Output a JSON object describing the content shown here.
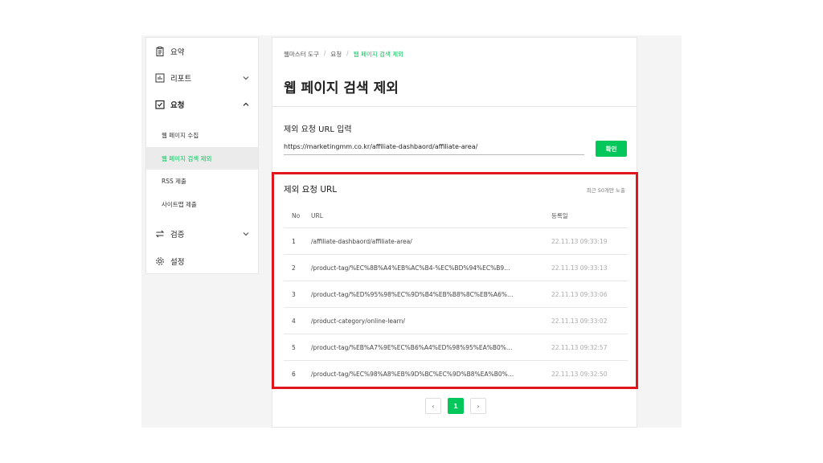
{
  "sidebar": {
    "items": [
      {
        "label": "요약",
        "icon": "clipboard-icon"
      },
      {
        "label": "리포트",
        "icon": "chart-icon"
      },
      {
        "label": "요청",
        "icon": "check-box-icon"
      },
      {
        "label": "검증",
        "icon": "swap-icon"
      },
      {
        "label": "설정",
        "icon": "gear-icon"
      }
    ],
    "sub_items": [
      {
        "label": "웹 페이지 수집"
      },
      {
        "label": "웹 페이지 검색 제외"
      },
      {
        "label": "RSS 제출"
      },
      {
        "label": "사이트맵 제출"
      }
    ]
  },
  "breadcrumb": [
    "웹마스터 도구",
    "요청",
    "웹 페이지 검색 제외"
  ],
  "page_title": "웹 페이지 검색 제외",
  "input_section": {
    "title": "제외 요청 URL 입력",
    "value": "https://marketingmm.co.kr/affiliate-dashbaord/affiliate-area/",
    "button_label": "확인"
  },
  "list_section": {
    "title": "제외 요청 URL",
    "note": "최근 50개만 노출",
    "headers": [
      "No",
      "URL",
      "등록일"
    ],
    "rows": [
      {
        "no": "1",
        "url": "/affiliate-dashbaord/affiliate-area/",
        "date": "22.11.13 09:33:19"
      },
      {
        "no": "2",
        "url": "/product-tag/%EC%8B%A4%EB%AC%B4-%EC%BD%94%EC%B9…",
        "date": "22.11.13 09:33:13"
      },
      {
        "no": "3",
        "url": "/product-tag/%ED%95%98%EC%9D%B4%EB%B8%8C%EB%A6%…",
        "date": "22.11.13 09:33:06"
      },
      {
        "no": "4",
        "url": "/product-category/online-learn/",
        "date": "22.11.13 09:33:02"
      },
      {
        "no": "5",
        "url": "/product-tag/%EB%A7%9E%EC%B6%A4%ED%98%95%EA%B0%…",
        "date": "22.11.13 09:32:57"
      },
      {
        "no": "6",
        "url": "/product-tag/%EC%98%A8%EB%9D%BC%EC%9D%B8%EA%B0%…",
        "date": "22.11.13 09:32:50"
      }
    ]
  },
  "pagination": {
    "prev": "‹",
    "current": "1",
    "next": "›"
  },
  "colors": {
    "accent": "#03c75a",
    "highlight": "#e0161c"
  }
}
